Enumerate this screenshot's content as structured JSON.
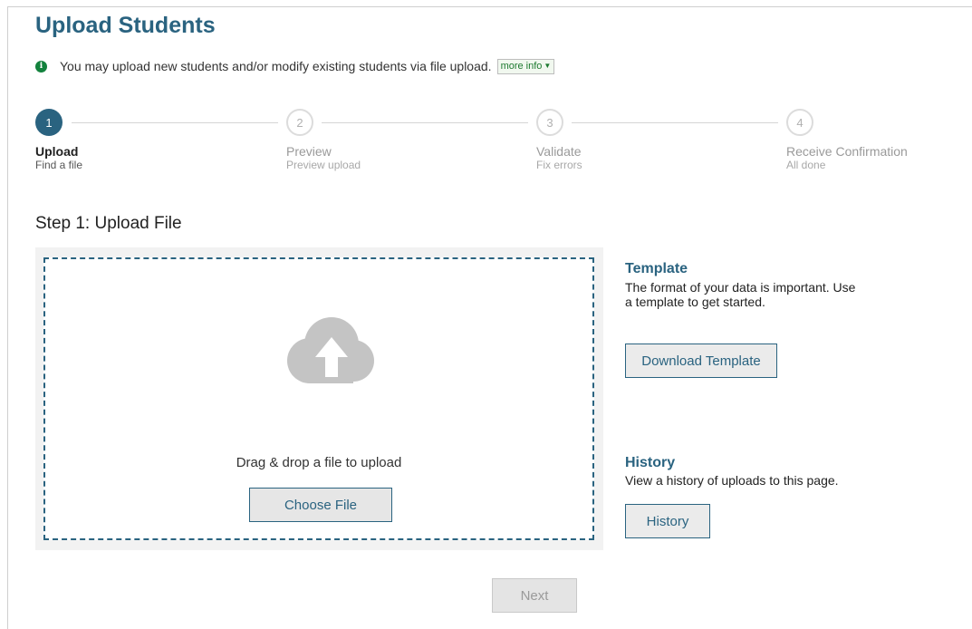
{
  "page": {
    "title": "Upload Students",
    "info_text": "You may upload new students and/or modify existing students via file upload.",
    "more_info_label": "more info",
    "step_heading": "Step 1: Upload File"
  },
  "stepper": {
    "steps": [
      {
        "number": "1",
        "title": "Upload",
        "subtitle": "Find a file",
        "state": "active"
      },
      {
        "number": "2",
        "title": "Preview",
        "subtitle": "Preview upload",
        "state": "inactive"
      },
      {
        "number": "3",
        "title": "Validate",
        "subtitle": "Fix errors",
        "state": "inactive"
      },
      {
        "number": "4",
        "title": "Receive Confirmation",
        "subtitle": "All done",
        "state": "inactive"
      }
    ]
  },
  "upload": {
    "drop_text": "Drag & drop a file to upload",
    "choose_label": "Choose File",
    "icon": "cloud-upload-icon"
  },
  "template": {
    "heading": "Template",
    "text": "The format of your data is important. Use a template to get started.",
    "button_label": "Download Template"
  },
  "history": {
    "heading": "History",
    "text": "View a history of uploads to this page.",
    "button_label": "History"
  },
  "footer": {
    "next_label": "Next"
  },
  "colors": {
    "brand": "#2a6380",
    "info": "#13823d",
    "panel": "#f2f2f2"
  }
}
